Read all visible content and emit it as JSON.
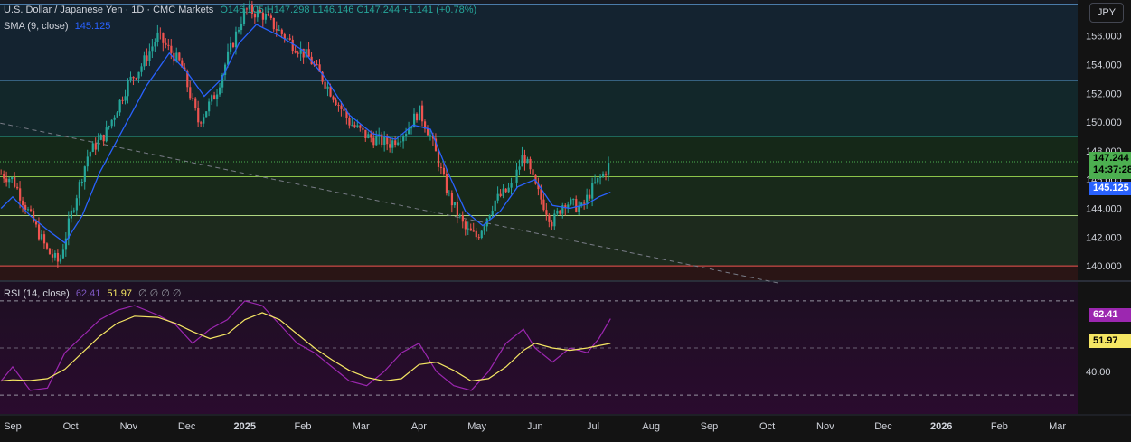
{
  "legend": {
    "symbol": "U.S. Dollar / Japanese Yen · 1D · CMC Markets",
    "ohlc": "O146.105 H147.298 L146.146 C147.244 +1.141 (+0.78%)",
    "sma_label": "SMA (9, close)",
    "sma_value": "145.125",
    "rsi_label": "RSI (14, close)",
    "rsi_value": "62.41",
    "rsi_ma_value": "51.97",
    "rsi_extra": "∅ ∅ ∅ ∅"
  },
  "currency": "JPY",
  "badges": {
    "price": "147.244",
    "countdown": "14:37:28",
    "sma": "145.125",
    "rsi": "62.41",
    "rsi_ma": "51.97"
  },
  "colors": {
    "up": "#26a69a",
    "down": "#ef5350",
    "sma": "#2962ff",
    "rsi": "#9c27b0",
    "rsi_ma": "#f5e663"
  },
  "chart_data": [
    {
      "type": "candlestick",
      "title": "U.S. Dollar / Japanese Yen · 1D · CMC Markets",
      "ylim": [
        139,
        158.5
      ],
      "y_ticks": [
        "140.000",
        "142.000",
        "144.000",
        "146.000",
        "148.000",
        "150.000",
        "152.000",
        "154.000",
        "156.000"
      ],
      "y_tick_values": [
        140,
        142,
        144,
        146,
        148,
        150,
        152,
        154,
        156
      ],
      "x_ticks": [
        "Sep",
        "Oct",
        "Nov",
        "Dec",
        "2025",
        "Feb",
        "Mar",
        "Apr",
        "May",
        "Jun",
        "Jul",
        "Aug",
        "Sep",
        "Oct",
        "Nov",
        "Dec",
        "2026",
        "Feb",
        "Mar"
      ],
      "horizontal_levels": [
        {
          "value": 158.2,
          "color": "#5b9bd5"
        },
        {
          "value": 152.9,
          "color": "#5b9bd5"
        },
        {
          "value": 149.0,
          "color": "#26a69a"
        },
        {
          "value": 146.2,
          "color": "#8bc34a"
        },
        {
          "value": 143.5,
          "color": "#aed581"
        },
        {
          "value": 140.0,
          "color": "#ef5350"
        }
      ],
      "trendline": {
        "from": {
          "month_index": -0.9,
          "value": 150.5
        },
        "to": {
          "month_index": 13.2,
          "value": 138.8
        }
      },
      "price_path": [
        [
          -0.2,
          146.4
        ],
        [
          0.0,
          146.0
        ],
        [
          0.3,
          143.5
        ],
        [
          0.6,
          141.0
        ],
        [
          0.8,
          140.2
        ],
        [
          1.0,
          143.5
        ],
        [
          1.3,
          147.8
        ],
        [
          1.6,
          149.2
        ],
        [
          2.0,
          152.8
        ],
        [
          2.2,
          153.8
        ],
        [
          2.5,
          156.0
        ],
        [
          2.9,
          154.0
        ],
        [
          3.2,
          150.0
        ],
        [
          3.5,
          152.0
        ],
        [
          3.7,
          154.5
        ],
        [
          4.0,
          157.8
        ],
        [
          4.3,
          157.5
        ],
        [
          4.8,
          155.5
        ],
        [
          5.1,
          154.5
        ],
        [
          5.5,
          152.0
        ],
        [
          5.8,
          150.0
        ],
        [
          6.1,
          149.0
        ],
        [
          6.5,
          148.5
        ],
        [
          6.8,
          149.5
        ],
        [
          7.0,
          150.8
        ],
        [
          7.2,
          149.0
        ],
        [
          7.5,
          145.0
        ],
        [
          7.8,
          142.5
        ],
        [
          8.0,
          142.0
        ],
        [
          8.3,
          144.5
        ],
        [
          8.6,
          145.5
        ],
        [
          8.8,
          147.8
        ],
        [
          9.0,
          145.5
        ],
        [
          9.3,
          143.0
        ],
        [
          9.5,
          144.5
        ],
        [
          9.8,
          144.0
        ],
        [
          10.0,
          145.5
        ],
        [
          10.2,
          146.5
        ],
        [
          10.3,
          147.244
        ]
      ],
      "sma_path": [
        [
          -0.2,
          144.0
        ],
        [
          0.0,
          144.8
        ],
        [
          0.3,
          143.5
        ],
        [
          0.6,
          142.5
        ],
        [
          0.9,
          141.6
        ],
        [
          1.2,
          143.5
        ],
        [
          1.5,
          146.5
        ],
        [
          1.9,
          149.5
        ],
        [
          2.3,
          152.5
        ],
        [
          2.7,
          154.8
        ],
        [
          3.0,
          153.5
        ],
        [
          3.3,
          151.8
        ],
        [
          3.6,
          153.0
        ],
        [
          3.9,
          155.5
        ],
        [
          4.2,
          156.8
        ],
        [
          4.6,
          156.0
        ],
        [
          5.0,
          155.0
        ],
        [
          5.4,
          153.0
        ],
        [
          5.8,
          150.5
        ],
        [
          6.2,
          149.2
        ],
        [
          6.6,
          148.8
        ],
        [
          6.9,
          149.8
        ],
        [
          7.2,
          149.5
        ],
        [
          7.5,
          146.5
        ],
        [
          7.8,
          143.8
        ],
        [
          8.1,
          142.8
        ],
        [
          8.4,
          143.8
        ],
        [
          8.7,
          145.5
        ],
        [
          9.0,
          146.0
        ],
        [
          9.3,
          144.2
        ],
        [
          9.6,
          144.0
        ],
        [
          9.9,
          144.3
        ],
        [
          10.1,
          144.8
        ],
        [
          10.3,
          145.125
        ]
      ]
    },
    {
      "type": "line",
      "title": "RSI (14, close)",
      "ylim": [
        22,
        78
      ],
      "y_ticks": [
        "40.00"
      ],
      "y_tick_values": [
        40
      ],
      "bands": [
        30,
        50,
        70
      ],
      "series": [
        {
          "name": "RSI (14, close)",
          "points": [
            [
              -0.2,
              36
            ],
            [
              0.0,
              42
            ],
            [
              0.3,
              32
            ],
            [
              0.6,
              33
            ],
            [
              0.9,
              48
            ],
            [
              1.2,
              55
            ],
            [
              1.5,
              62
            ],
            [
              1.8,
              66
            ],
            [
              2.1,
              68
            ],
            [
              2.5,
              64
            ],
            [
              2.8,
              60
            ],
            [
              3.1,
              52
            ],
            [
              3.4,
              58
            ],
            [
              3.7,
              62
            ],
            [
              4.0,
              70
            ],
            [
              4.3,
              68
            ],
            [
              4.6,
              60
            ],
            [
              4.9,
              52
            ],
            [
              5.2,
              48
            ],
            [
              5.5,
              42
            ],
            [
              5.8,
              36
            ],
            [
              6.1,
              34
            ],
            [
              6.4,
              40
            ],
            [
              6.7,
              48
            ],
            [
              7.0,
              52
            ],
            [
              7.3,
              40
            ],
            [
              7.6,
              34
            ],
            [
              7.9,
              32
            ],
            [
              8.2,
              40
            ],
            [
              8.5,
              52
            ],
            [
              8.8,
              58
            ],
            [
              9.0,
              50
            ],
            [
              9.3,
              44
            ],
            [
              9.6,
              50
            ],
            [
              9.9,
              48
            ],
            [
              10.1,
              54
            ],
            [
              10.3,
              62.41
            ]
          ]
        },
        {
          "name": "RSI MA",
          "points": [
            [
              -0.2,
              36
            ],
            [
              0.0,
              36.5
            ],
            [
              0.3,
              36.2
            ],
            [
              0.6,
              37
            ],
            [
              0.9,
              41
            ],
            [
              1.2,
              48
            ],
            [
              1.5,
              55
            ],
            [
              1.8,
              60.5
            ],
            [
              2.1,
              63.5
            ],
            [
              2.5,
              63
            ],
            [
              2.8,
              60.5
            ],
            [
              3.1,
              57
            ],
            [
              3.4,
              54
            ],
            [
              3.7,
              56
            ],
            [
              4.0,
              62
            ],
            [
              4.3,
              65
            ],
            [
              4.6,
              62
            ],
            [
              4.9,
              56
            ],
            [
              5.2,
              50
            ],
            [
              5.5,
              45
            ],
            [
              5.8,
              40.5
            ],
            [
              6.1,
              37.5
            ],
            [
              6.4,
              36
            ],
            [
              6.7,
              37
            ],
            [
              7.0,
              43
            ],
            [
              7.3,
              44
            ],
            [
              7.6,
              40.5
            ],
            [
              7.9,
              36
            ],
            [
              8.2,
              37
            ],
            [
              8.5,
              42
            ],
            [
              8.8,
              49
            ],
            [
              9.0,
              52
            ],
            [
              9.3,
              50
            ],
            [
              9.6,
              49
            ],
            [
              9.9,
              50
            ],
            [
              10.1,
              51
            ],
            [
              10.3,
              51.97
            ]
          ]
        }
      ]
    }
  ]
}
